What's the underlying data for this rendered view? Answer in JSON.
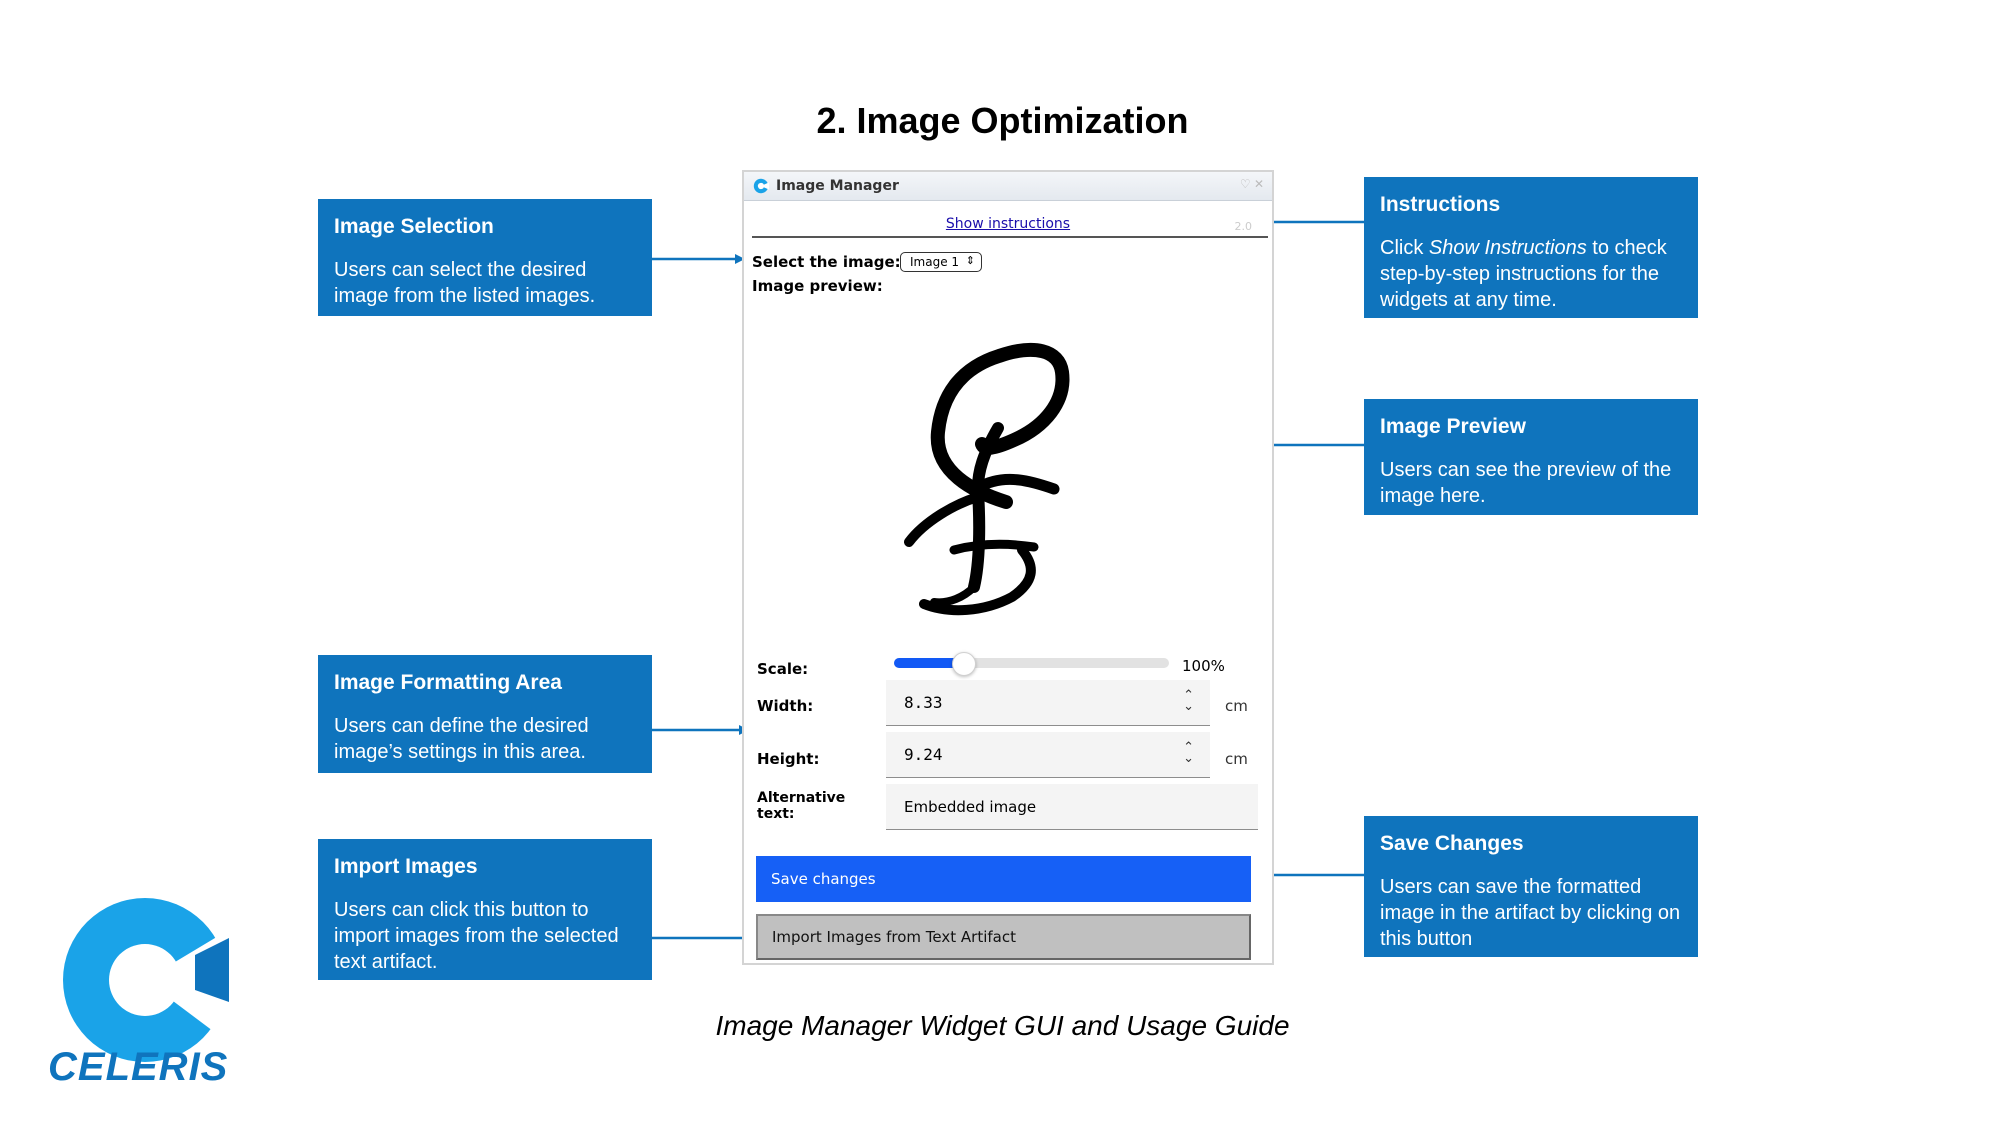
{
  "slide": {
    "title": "2. Image Optimization",
    "caption": "Image Manager Widget GUI and Usage Guide",
    "logo_text": "CELERIS"
  },
  "colors": {
    "callout_bg": "#0f74bd",
    "save_button": "#1660f6",
    "import_button": "#c0c0c0",
    "logo_cyan": "#1aa3e8",
    "logo_blue": "#0f74bd"
  },
  "callouts": {
    "selection": {
      "title": "Image Selection",
      "body": "Users can select the desired image from the listed images."
    },
    "instructions": {
      "title": "Instructions",
      "body_prefix": "Click ",
      "body_emph": "Show Instructions",
      "body_suffix": " to check step-by-step instructions for the widgets at any time."
    },
    "preview": {
      "title": "Image Preview",
      "body": "Users can see the preview of the image here."
    },
    "formatting": {
      "title": "Image Formatting Area",
      "body": "Users can define the desired image’s settings in this area."
    },
    "import": {
      "title": "Import Images",
      "body": "Users can click this button to import images from the selected text artifact."
    },
    "save": {
      "title": "Save Changes",
      "body": "Users can save the formatted image in the artifact by clicking on this button"
    }
  },
  "widget": {
    "window_title": "Image Manager",
    "show_instructions": "Show instructions",
    "version": "2.0",
    "select_label": "Select the image:",
    "selected_image": "Image 1",
    "preview_label": "Image preview:",
    "scale_label": "Scale:",
    "scale_percent": 100,
    "scale_display": "100%",
    "width_label": "Width:",
    "width_value": "8.33",
    "height_label": "Height:",
    "height_value": "9.24",
    "unit": "cm",
    "alt_label_line1": "Alternative",
    "alt_label_line2": "text:",
    "alt_value": "Embedded image",
    "save_button": "Save changes",
    "import_button": "Import Images from Text Artifact"
  }
}
